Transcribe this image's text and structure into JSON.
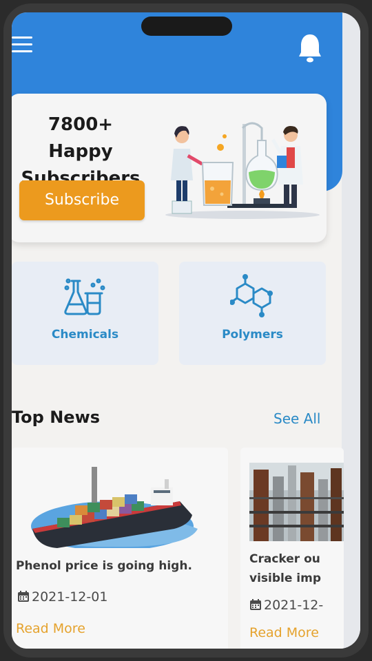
{
  "promo": {
    "title": "7800+ Happy Subscribers",
    "button_label": "Subscribe"
  },
  "categories": [
    {
      "label": "Chemicals",
      "icon": "flask-icon"
    },
    {
      "label": "Polymers",
      "icon": "molecule-icon"
    }
  ],
  "top_news": {
    "title": "Top News",
    "see_all_label": "See All",
    "articles": [
      {
        "title": "Phenol price is going high.",
        "date": "2021-12-01",
        "read_more": "Read More",
        "image": "cargo-ship-image"
      },
      {
        "title": "Cracker ou visible imp",
        "date": "2021-12-",
        "read_more": "Read More",
        "image": "refinery-image"
      }
    ]
  },
  "colors": {
    "header_blue": "#2f84db",
    "accent_orange": "#ec9a1e",
    "link_blue": "#2a8ac6",
    "read_more_orange": "#e5a22c"
  }
}
